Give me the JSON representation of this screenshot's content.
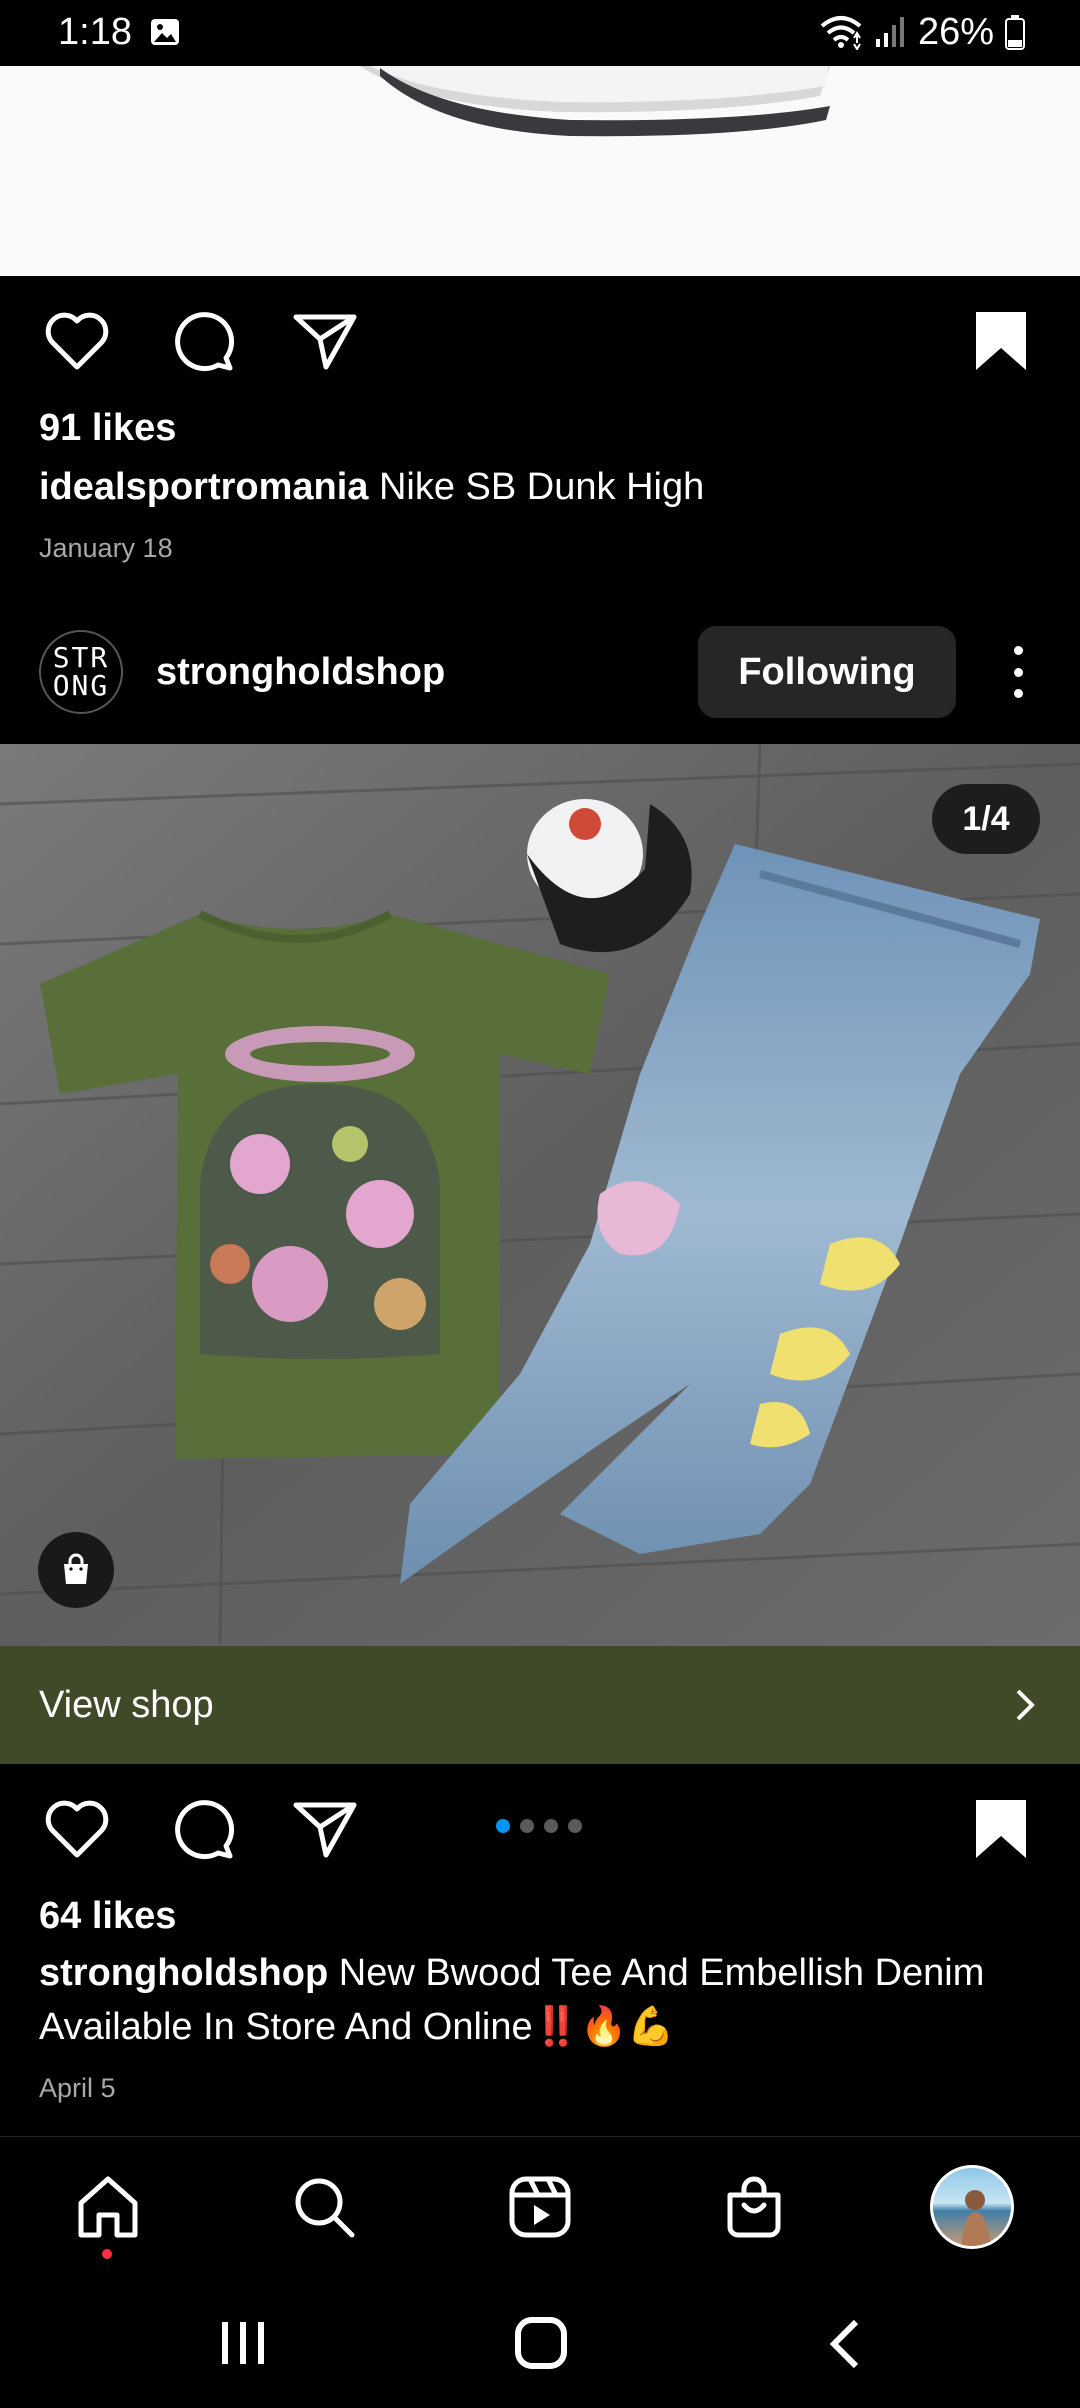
{
  "status_bar": {
    "time": "1:18",
    "battery": "26%",
    "icons": [
      "gallery-icon",
      "wifi-icon",
      "signal-icon",
      "battery-icon"
    ]
  },
  "previous_post": {
    "likes": "91 likes",
    "caption_user": "idealsportromania",
    "caption_text": " Nike SB Dunk High",
    "date": "January 18",
    "icons": [
      "heart-icon",
      "comment-icon",
      "share-icon",
      "bookmark-icon"
    ]
  },
  "post": {
    "avatar_text_line1": "STR",
    "avatar_text_line2": "ONG",
    "username": "strongholdshop",
    "follow_label": "Following",
    "carousel_counter": "1/4",
    "view_shop_label": "View shop",
    "likes": "64 likes",
    "caption_user": "strongholdshop",
    "caption_text": " New Bwood Tee And Embellish Denim Available In Store And Online‼️🔥💪",
    "date": "April 5",
    "carousel_active_index": 0,
    "carousel_total": 4
  },
  "bottom_nav": {
    "items": [
      "home-icon",
      "search-icon",
      "reels-icon",
      "shop-icon",
      "profile-avatar"
    ]
  },
  "colors": {
    "background": "#000000",
    "view_shop_bg": "#414a28",
    "following_bg": "#262626",
    "active_dot": "#0095f6",
    "notification_dot": "#ff3040"
  }
}
